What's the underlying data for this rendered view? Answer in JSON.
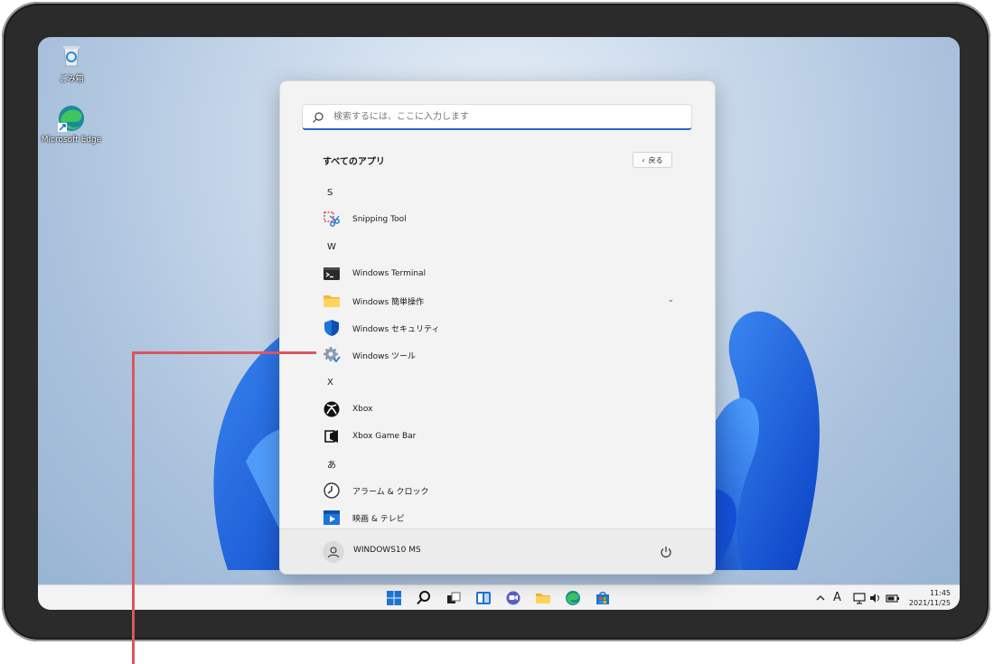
{
  "desktop": {
    "icons": [
      {
        "label": "ごみ箱",
        "icon": "recycle-bin-icon"
      },
      {
        "label": "Microsoft Edge",
        "icon": "edge-icon"
      }
    ]
  },
  "start_menu": {
    "search": {
      "placeholder": "検索するには、ここに入力します"
    },
    "section_title": "すべてのアプリ",
    "back_label": "戻る",
    "groups": [
      {
        "letter": "S"
      },
      {
        "letter": "W"
      },
      {
        "letter": "X"
      },
      {
        "letter": "あ"
      }
    ],
    "apps": [
      {
        "name": "Snipping Tool",
        "icon": "snipping-tool-icon"
      },
      {
        "name": "Windows Terminal",
        "icon": "terminal-icon"
      },
      {
        "name": "Windows 簡単操作",
        "icon": "folder-icon"
      },
      {
        "name": "Windows セキュリティ",
        "icon": "shield-icon"
      },
      {
        "name": "Windows ツール",
        "icon": "gear-icon"
      },
      {
        "name": "Xbox",
        "icon": "xbox-icon"
      },
      {
        "name": "Xbox Game Bar",
        "icon": "game-bar-icon"
      },
      {
        "name": "アラーム & クロック",
        "icon": "clock-icon"
      },
      {
        "name": "映画 & テレビ",
        "icon": "movies-icon"
      }
    ],
    "user": {
      "name": "WINDOWS10 MS"
    }
  },
  "taskbar": {
    "clock": {
      "time": "11:45",
      "date": "2021/11/25"
    },
    "ime": "A"
  },
  "colors": {
    "accent": "#2a63c7",
    "callout": "#d9575e"
  }
}
